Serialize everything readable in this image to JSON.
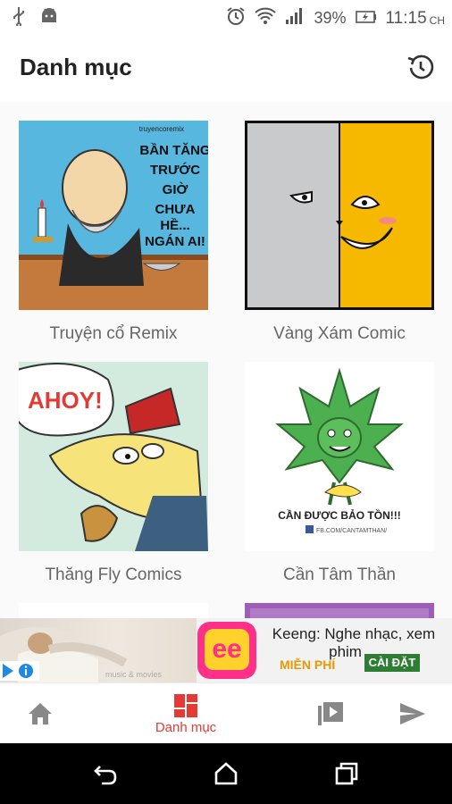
{
  "status": {
    "battery": "39%",
    "time": "11:15",
    "ampm": "CH"
  },
  "appbar": {
    "title": "Danh mục"
  },
  "categories": [
    {
      "label": "Truyện cổ Remix",
      "thumb_text_lines": [
        "BẦN TĂNG",
        "TRƯỚC",
        "GIỜ",
        "CHƯA",
        "HỀ...",
        "NGÁN AI!"
      ],
      "thumb_credit": "truyencoremix"
    },
    {
      "label": "Vàng Xám Comic"
    },
    {
      "label": "Thăng Fly Comics",
      "thumb_text": "AHOY!"
    },
    {
      "label": "Cần Tâm Thần",
      "thumb_text": "CẦN ĐƯỢC BẢO TỒN!!!",
      "thumb_credit": "FB.COM/CANTAMTHAN/"
    }
  ],
  "ad": {
    "app_logo": "ee",
    "title": "Keeng: Nghe nhạc, xem phim ...",
    "free_label": "MIỄN PHÍ",
    "install_label": "CÀI ĐẶT",
    "photo_caption": "music & movies"
  },
  "bottom_nav": {
    "active_label": "Danh mục",
    "accent": "#e53935"
  }
}
